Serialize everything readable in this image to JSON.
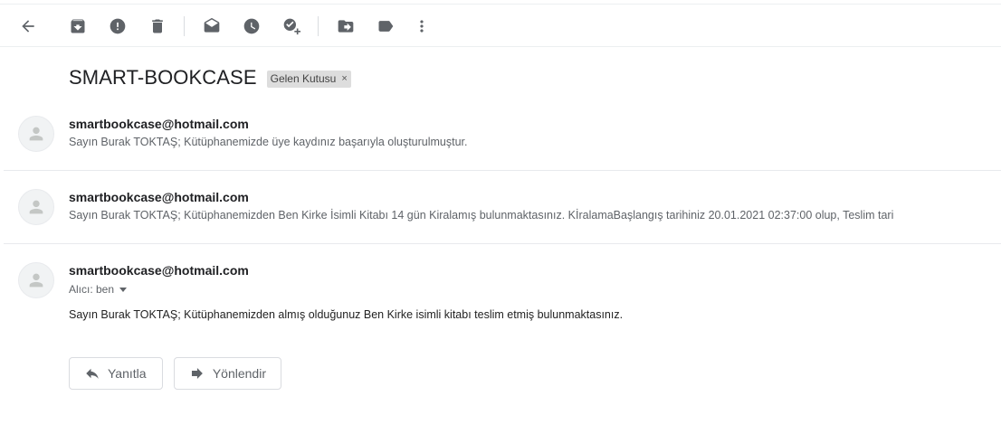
{
  "toolbar": {
    "icons": [
      "back-arrow-icon",
      "archive-icon",
      "report-spam-icon",
      "delete-icon",
      "mark-unread-icon",
      "snooze-icon",
      "add-to-tasks-icon",
      "move-to-icon",
      "labels-icon",
      "more-icon"
    ]
  },
  "thread": {
    "subject": "SMART-BOOKCASE",
    "label": "Gelen Kutusu",
    "label_remove": "×"
  },
  "messages": [
    {
      "sender": "smartbookcase@hotmail.com",
      "snippet": "Sayın Burak TOKTAŞ; Kütüphanemizde üye kaydınız başarıyla oluşturulmuştur."
    },
    {
      "sender": "smartbookcase@hotmail.com",
      "snippet": "Sayın Burak TOKTAŞ; Kütüphanemizden Ben Kirke İsimli Kitabı 14 gün Kiralamış bulunmaktasınız. KİralamaBaşlangış tarihiniz 20.01.2021 02:37:00 olup, Teslim tari"
    },
    {
      "sender": "smartbookcase@hotmail.com",
      "to": "Alıcı: ben",
      "body": "Sayın Burak TOKTAŞ; Kütüphanemizden almış olduğunuz Ben Kirke isimli kitabı teslim etmiş bulunmaktasınız."
    }
  ],
  "actions": {
    "reply": "Yanıtla",
    "forward": "Yönlendir"
  }
}
